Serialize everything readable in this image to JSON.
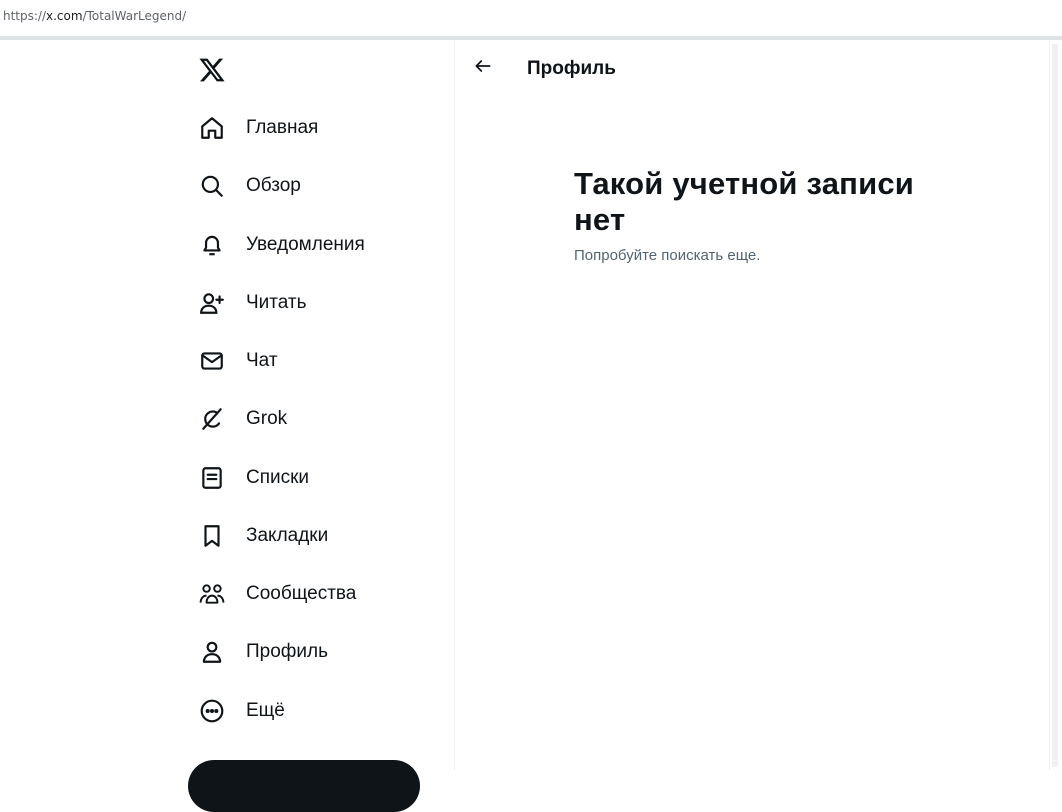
{
  "browser": {
    "url_scheme": "https://",
    "url_host": "x.com",
    "url_path": "/TotalWarLegend/"
  },
  "sidebar": {
    "logo_icon": "x-logo-icon",
    "items": [
      {
        "label": "Главная",
        "icon": "home-icon"
      },
      {
        "label": "Обзор",
        "icon": "search-icon"
      },
      {
        "label": "Уведомления",
        "icon": "bell-icon"
      },
      {
        "label": "Читать",
        "icon": "follow-user-icon"
      },
      {
        "label": "Чат",
        "icon": "mail-icon"
      },
      {
        "label": "Grok",
        "icon": "grok-icon"
      },
      {
        "label": "Списки",
        "icon": "list-icon"
      },
      {
        "label": "Закладки",
        "icon": "bookmark-icon"
      },
      {
        "label": "Сообщества",
        "icon": "communities-icon"
      },
      {
        "label": "Профиль",
        "icon": "profile-icon"
      },
      {
        "label": "Ещё",
        "icon": "more-circle-icon"
      }
    ]
  },
  "main": {
    "header_title": "Профиль",
    "back_icon": "arrow-left-icon",
    "empty_title": "Такой учетной записи нет",
    "empty_subtitle": "Попробуйте поискать еще."
  },
  "colors": {
    "text_primary": "#0f1419",
    "text_secondary": "#536471",
    "border": "#eff3f4"
  }
}
